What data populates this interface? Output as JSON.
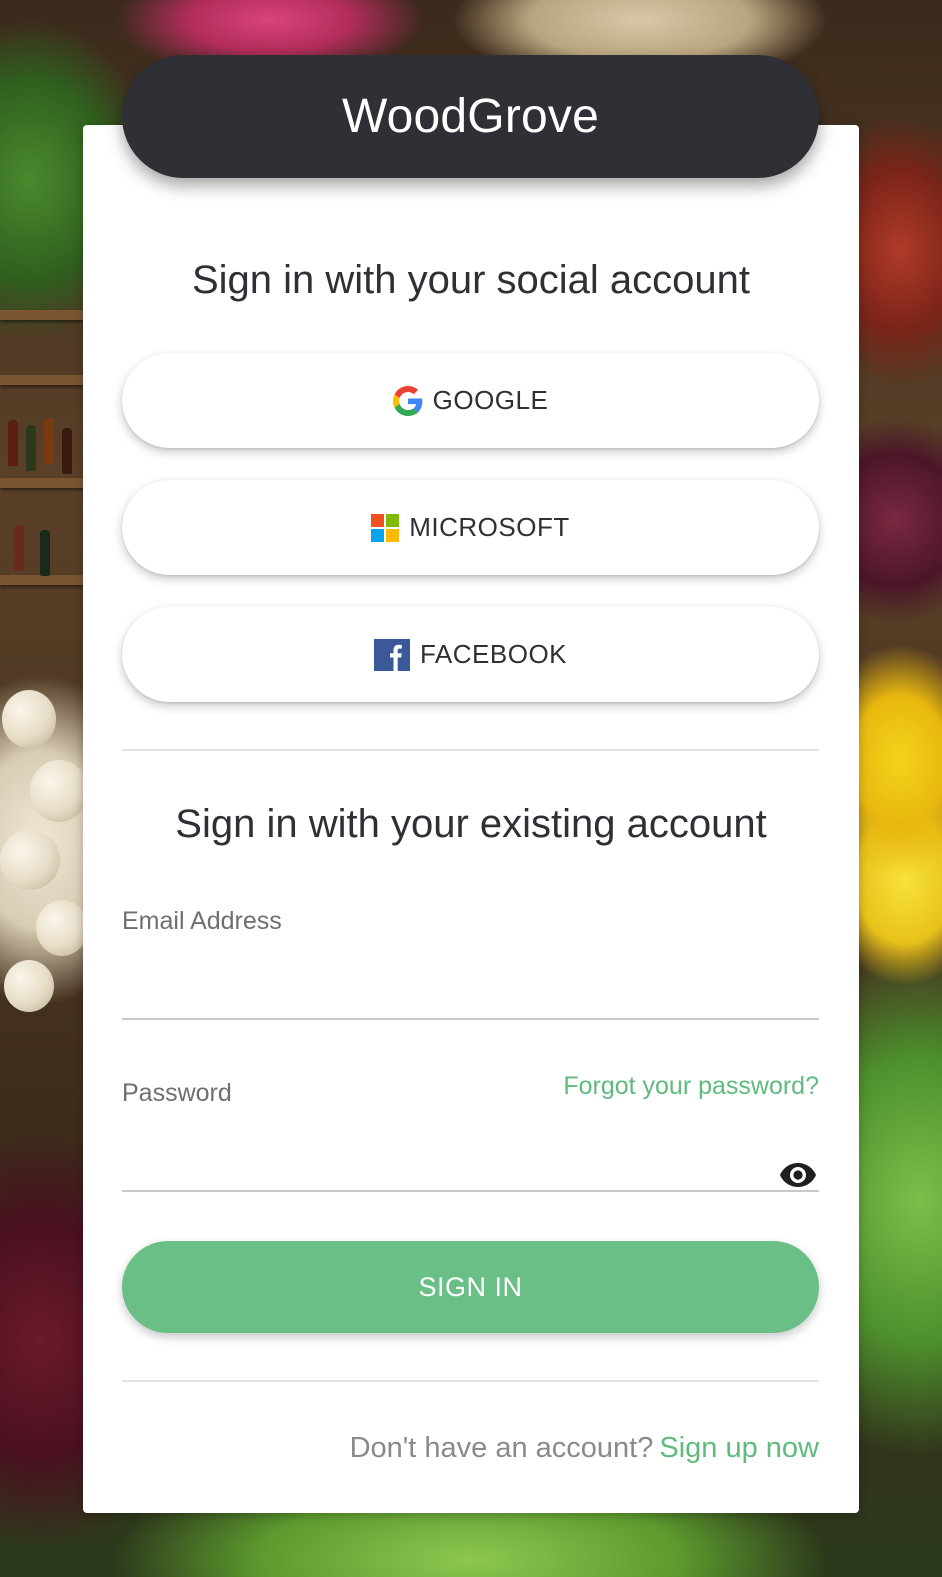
{
  "brand": {
    "title": "WoodGrove"
  },
  "social_section": {
    "heading": "Sign in with your social account",
    "providers": [
      {
        "label": "GOOGLE",
        "icon": "google-icon"
      },
      {
        "label": "MICROSOFT",
        "icon": "microsoft-icon"
      },
      {
        "label": "FACEBOOK",
        "icon": "facebook-icon"
      }
    ]
  },
  "local_section": {
    "heading": "Sign in with your existing account",
    "email_label": "Email Address",
    "email_value": "",
    "password_label": "Password",
    "password_value": "",
    "forgot_password_link": "Forgot your password?",
    "show_password_icon": "eye-icon",
    "sign_in_button": "SIGN IN"
  },
  "footer": {
    "no_account_text": "Don't have an account?",
    "sign_up_link": "Sign up now"
  },
  "colors": {
    "brand_bar": "#2f3035",
    "accent_green": "#69bf85",
    "link_green": "#5fba7d",
    "card_background": "#ffffff",
    "google_blue": "#4285F4",
    "google_red": "#EA4335",
    "google_yellow": "#FBBC05",
    "google_green": "#34A853",
    "microsoft_red": "#F25022",
    "microsoft_green": "#7FBA00",
    "microsoft_blue": "#00A4EF",
    "microsoft_yellow": "#FFB900",
    "facebook_blue": "#3b5998"
  }
}
